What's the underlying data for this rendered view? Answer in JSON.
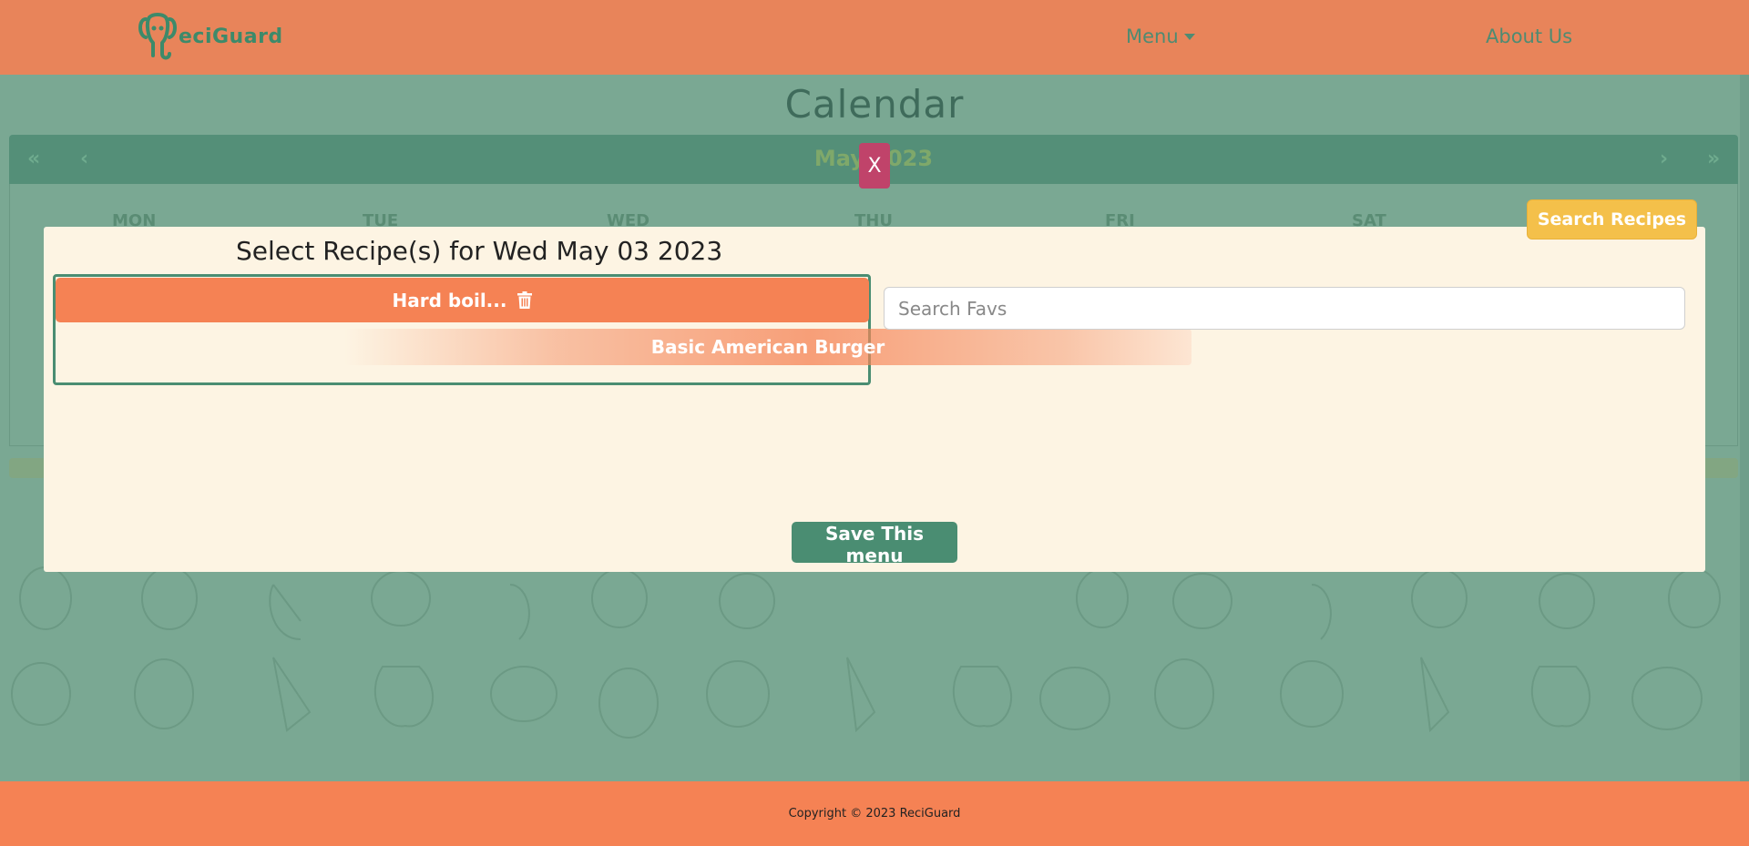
{
  "header": {
    "logo_text": "eciGuard",
    "nav_menu": "Menu",
    "nav_about": "About Us"
  },
  "calendar": {
    "title": "Calendar",
    "month": "May 2023",
    "nav_first": "«",
    "nav_prev": "‹",
    "nav_next": "›",
    "nav_last": "»",
    "weekdays": [
      "MON",
      "TUE",
      "WED",
      "THU",
      "FRI",
      "SAT"
    ]
  },
  "close_label": "X",
  "search_recipes_label": "Search Recipes",
  "modal": {
    "title": "Select Recipe(s) for Wed May 03 2023",
    "selected_recipe": "Hard boil...",
    "dragging_recipe": "Basic American Burger",
    "search_placeholder": "Search Favs",
    "save_label": "Save This menu"
  },
  "footer": {
    "copyright": "Copyright © 2023 ReciGuard"
  },
  "colors": {
    "header": "#e8845a",
    "accent_green": "#4a8d72",
    "recipe_orange": "#f58254",
    "close_pink": "#c0436a",
    "search_yellow": "#f4c04a"
  }
}
